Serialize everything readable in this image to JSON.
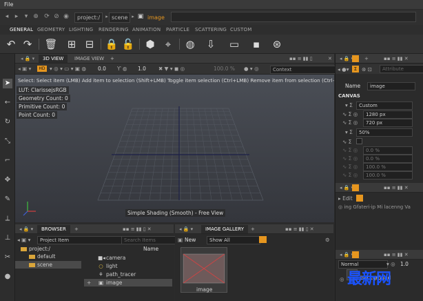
{
  "menu": {
    "file": "File"
  },
  "path": {
    "project": "project:/",
    "scene": "scene",
    "current": "image"
  },
  "tabs": [
    "GENERAL",
    "GEOMETRY",
    "LIGHTING",
    "RENDERING",
    "ANIMATION",
    "PARTICLE",
    "SCATTERING",
    "CUSTOM"
  ],
  "viewport": {
    "tab_3d": "3D VIEW",
    "tab_image": "IMAGE VIEW",
    "add_tab": "+",
    "mode_value": "0.0",
    "scale_value": "1.0",
    "zoom_value": "100.0 %",
    "context_label": "Context",
    "hint": "Select: Select item (LMB)  Add item to selection (Shift+LMB)  Toggle item selection (Ctrl+LMB)  Remove item from selection (Ctrl+",
    "lut": "LUT: ClarissejsRGB",
    "geometry_count": "Geometry Count: 0",
    "primitive_count": "Primitive Count: 0",
    "point_count": "Point Count: 0",
    "status": "Simple Shading (Smooth) - Free View"
  },
  "attributes": {
    "search_placeholder": "Attribute",
    "name_label": "Name",
    "name_value": "image",
    "section": "CANVAS",
    "preset": "Custom",
    "width": "1280 px",
    "height": "720 px",
    "ratio": "50%",
    "values": [
      "0.0 %",
      "0.0 %",
      "100.0 %",
      "100.0 %"
    ]
  },
  "edit_panel": {
    "label": "Edit",
    "text": "ing Gfateri·ip Mi lacenng Va"
  },
  "layers_panel": {
    "blend": "Normal",
    "opacity": "1.0",
    "layer": "background"
  },
  "browser": {
    "title": "BROWSER",
    "add_tab": "+",
    "project_item": "Project Item",
    "search_placeholder": "Search Items",
    "col_name": "Name",
    "tree": [
      "project:/",
      "default",
      "scene"
    ],
    "items": [
      "camera",
      "light",
      "path_tracer",
      "image"
    ]
  },
  "gallery": {
    "title": "IMAGE GALLERY",
    "add_tab": "+",
    "new_label": "New",
    "show_label": "Show All",
    "thumb_label": "image"
  },
  "watermark": "最新网"
}
